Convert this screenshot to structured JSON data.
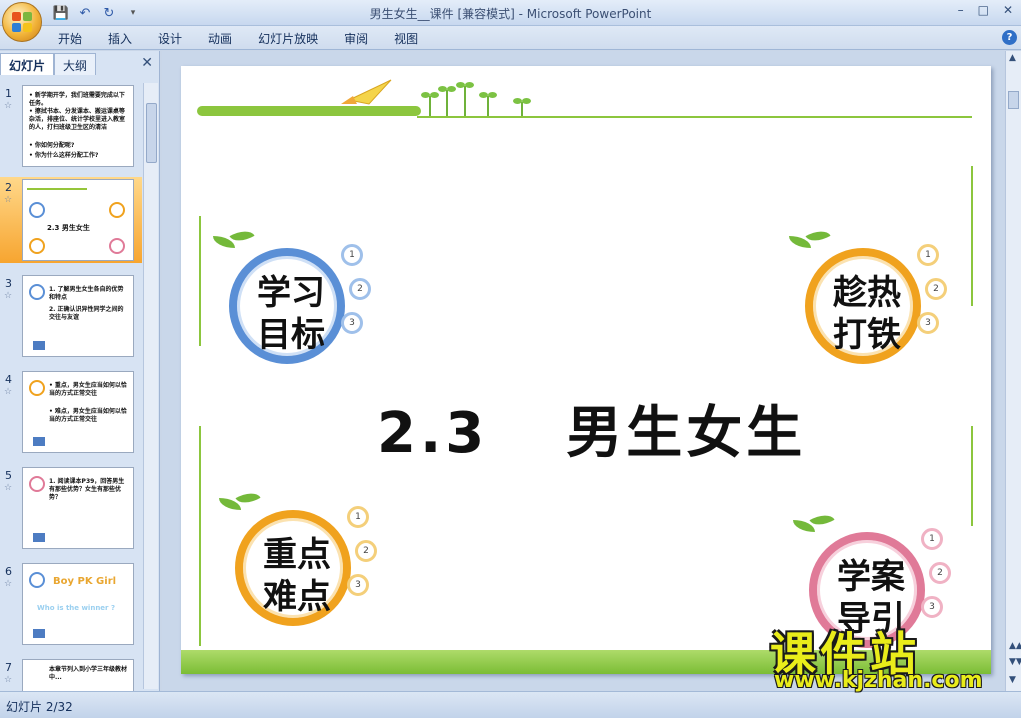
{
  "window": {
    "title": "男生女生__课件 [兼容模式] - Microsoft PowerPoint"
  },
  "quick_access": {
    "save_icon": "floppy-icon",
    "undo_icon": "undo-icon",
    "redo_icon": "redo-icon"
  },
  "ribbon": {
    "tabs": [
      "开始",
      "插入",
      "设计",
      "动画",
      "幻灯片放映",
      "审阅",
      "视图"
    ],
    "help": "?"
  },
  "win_controls": {
    "minimize": "–",
    "maximize": "□",
    "close": "✕"
  },
  "left_panel": {
    "tabs": [
      "幻灯片",
      "大纲"
    ],
    "close": "✕",
    "thumbnails": [
      {
        "num": "1",
        "text": [
          "• 新学期开学，我们班需要完成以下任务。",
          "• 擦拭书本、分发课本、搬运课桌等杂活，排座位、统计学校里进入教室的人，打扫班级卫生区的清洁",
          "• 你如何分配呢?",
          "• 你为什么这样分配工作?"
        ]
      },
      {
        "num": "2",
        "text": [
          "2.3    男生女生"
        ]
      },
      {
        "num": "3",
        "text": [
          "1. 了解男生女生各自的优势和特点",
          "2. 正确认识异性同学之间的交往与友谊"
        ]
      },
      {
        "num": "4",
        "text": [
          "• 重点，男女生应当如何以恰当的方式正常交往",
          "• 难点，男女生应当如何以恰当的方式正常交往"
        ]
      },
      {
        "num": "5",
        "text": [
          "1. 阅读课本P39，回答男生有那些优势？女生有那些优势？"
        ]
      },
      {
        "num": "6",
        "text": [
          "Boy PK Girl",
          "Who is the winner ?"
        ]
      },
      {
        "num": "7",
        "text": [
          "本章节列入到小学三年级教材中..."
        ]
      }
    ]
  },
  "slide": {
    "title_num": "2.3",
    "title_text": "男生女生",
    "badges": [
      {
        "chars": [
          "学",
          "习",
          "目",
          "标"
        ],
        "minis": [
          "1",
          "2",
          "3"
        ]
      },
      {
        "chars": [
          "趁",
          "热",
          "打",
          "铁"
        ],
        "minis": [
          "1",
          "2",
          "3"
        ]
      },
      {
        "chars": [
          "重",
          "点",
          "难",
          "点"
        ],
        "minis": [
          "1",
          "2",
          "3"
        ]
      },
      {
        "chars": [
          "学",
          "案",
          "导",
          "引"
        ],
        "minis": [
          "1",
          "2",
          "3"
        ]
      }
    ]
  },
  "watermark": {
    "main": "课件站",
    "url": "www.kjzhan.com"
  },
  "status": {
    "slide_info": "幻灯片 2/32"
  },
  "colors": {
    "green": "#8cc63e",
    "blue_ring": "#5a8fd6",
    "orange_ring": "#f0a21e",
    "pink_ring": "#e07a98",
    "selected_thumb": "#f7a530"
  }
}
